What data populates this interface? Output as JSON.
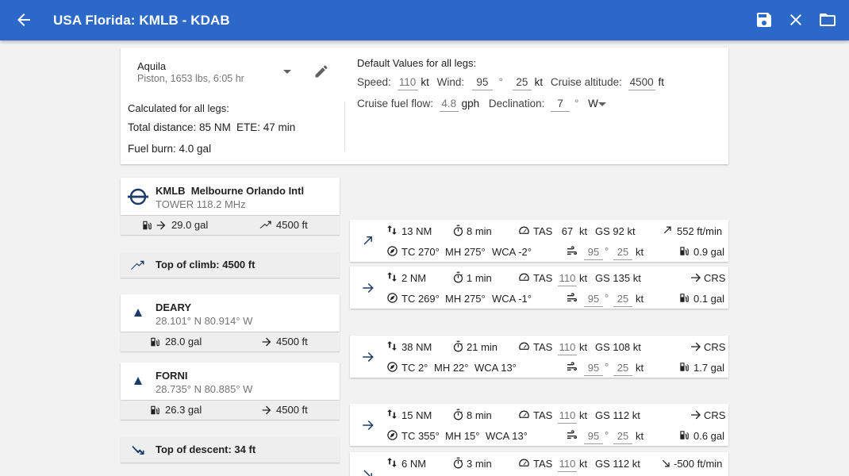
{
  "appbar": {
    "title": "USA Florida: KMLB - KDAB"
  },
  "aircraft": {
    "name": "Aquila",
    "details": "Piston, 1653 lbs, 6:05 hr"
  },
  "calculated": {
    "heading": "Calculated for all legs:",
    "total_distance": "Total distance: 85 NM",
    "ete": "ETE: 47 min",
    "fuel_burn": "Fuel burn: 4.0 gal"
  },
  "defaults": {
    "heading": "Default Values for all legs:",
    "speed_label": "Speed:",
    "speed": "110",
    "speed_unit": "kt",
    "wind_label": "Wind:",
    "wind_dir": "95",
    "deg": "°",
    "wind_speed": "25",
    "wind_unit": "kt",
    "alt_label": "Cruise altitude:",
    "alt": "4500",
    "alt_unit": "ft",
    "fuel_label": "Cruise fuel flow:",
    "fuel": "4.8",
    "fuel_unit": "gph",
    "decl_label": "Declination:",
    "decl": "7",
    "decl_dir": "W"
  },
  "waypoints": {
    "kmlb": {
      "id": "KMLB",
      "name": "Melbourne Orlando Intl",
      "sub": "TOWER 118.2 MHz",
      "fuel": "29.0 gal",
      "alt": "4500 ft"
    },
    "toc": "Top of climb: 4500 ft",
    "deary": {
      "name": "DEARY",
      "coords": "28.101° N 80.914° W",
      "fuel": "28.0 gal",
      "alt": "4500 ft"
    },
    "forni": {
      "name": "FORNI",
      "coords": "28.735° N 80.885° W",
      "fuel": "26.3 gal",
      "alt": "4500 ft"
    },
    "tod": "Top of descent: 34 ft"
  },
  "legs": [
    {
      "dist": "13 NM",
      "time": "8 min",
      "tas_label": "TAS",
      "tas": "67",
      "tas_unit": "kt",
      "gs": "GS 92 kt",
      "vs": "552 ft/min",
      "tc": "TC 270°",
      "mh": "MH 275°",
      "wca": "WCA -2°",
      "wdir": "95",
      "deg": "°",
      "wspd": "25",
      "wunit": "kt",
      "fuel": "0.9 gal"
    },
    {
      "dist": "2 NM",
      "time": "1 min",
      "tas_label": "TAS",
      "tas": "110",
      "tas_unit": "kt",
      "gs": "GS 135 kt",
      "vs": "CRS",
      "tc": "TC 269°",
      "mh": "MH 275°",
      "wca": "WCA -1°",
      "wdir": "95",
      "deg": "°",
      "wspd": "25",
      "wunit": "kt",
      "fuel": "0.1 gal"
    },
    {
      "dist": "38 NM",
      "time": "21 min",
      "tas_label": "TAS",
      "tas": "110",
      "tas_unit": "kt",
      "gs": "GS 108 kt",
      "vs": "CRS",
      "tc": "TC 2°",
      "mh": "MH 22°",
      "wca": "WCA 13°",
      "wdir": "95",
      "deg": "°",
      "wspd": "25",
      "wunit": "kt",
      "fuel": "1.7 gal"
    },
    {
      "dist": "15 NM",
      "time": "8 min",
      "tas_label": "TAS",
      "tas": "110",
      "tas_unit": "kt",
      "gs": "GS 112 kt",
      "vs": "CRS",
      "tc": "TC 355°",
      "mh": "MH 15°",
      "wca": "WCA 13°",
      "wdir": "95",
      "deg": "°",
      "wspd": "25",
      "wunit": "kt",
      "fuel": "0.6 gal"
    },
    {
      "dist": "6 NM",
      "time": "3 min",
      "tas_label": "TAS",
      "tas": "110",
      "tas_unit": "kt",
      "gs": "GS 112 kt",
      "vs": "-500 ft/min"
    }
  ],
  "icons": {
    "back": "arrow-left-icon",
    "save": "floppy-disk-icon",
    "close": "close-icon",
    "open": "folder-icon",
    "edit": "pencil-icon",
    "dropdown": "caret-down-icon",
    "airport": "airport-icon",
    "waypoint": "triangle-icon",
    "fuel": "fuel-pump-icon",
    "climb": "arrow-up-right-icon",
    "descent": "arrow-down-right-icon",
    "cruise": "arrow-right-icon",
    "distance": "up-down-arrows-icon",
    "time": "stopwatch-icon",
    "speed": "speedometer-icon",
    "course": "compass-icon",
    "wind": "wind-icon",
    "fuel_calc": "fuel-calc-icon"
  },
  "colors": {
    "appbar": "#2c68c7",
    "icon_dark": "#1c3b66",
    "background": "#f2f2f2"
  }
}
